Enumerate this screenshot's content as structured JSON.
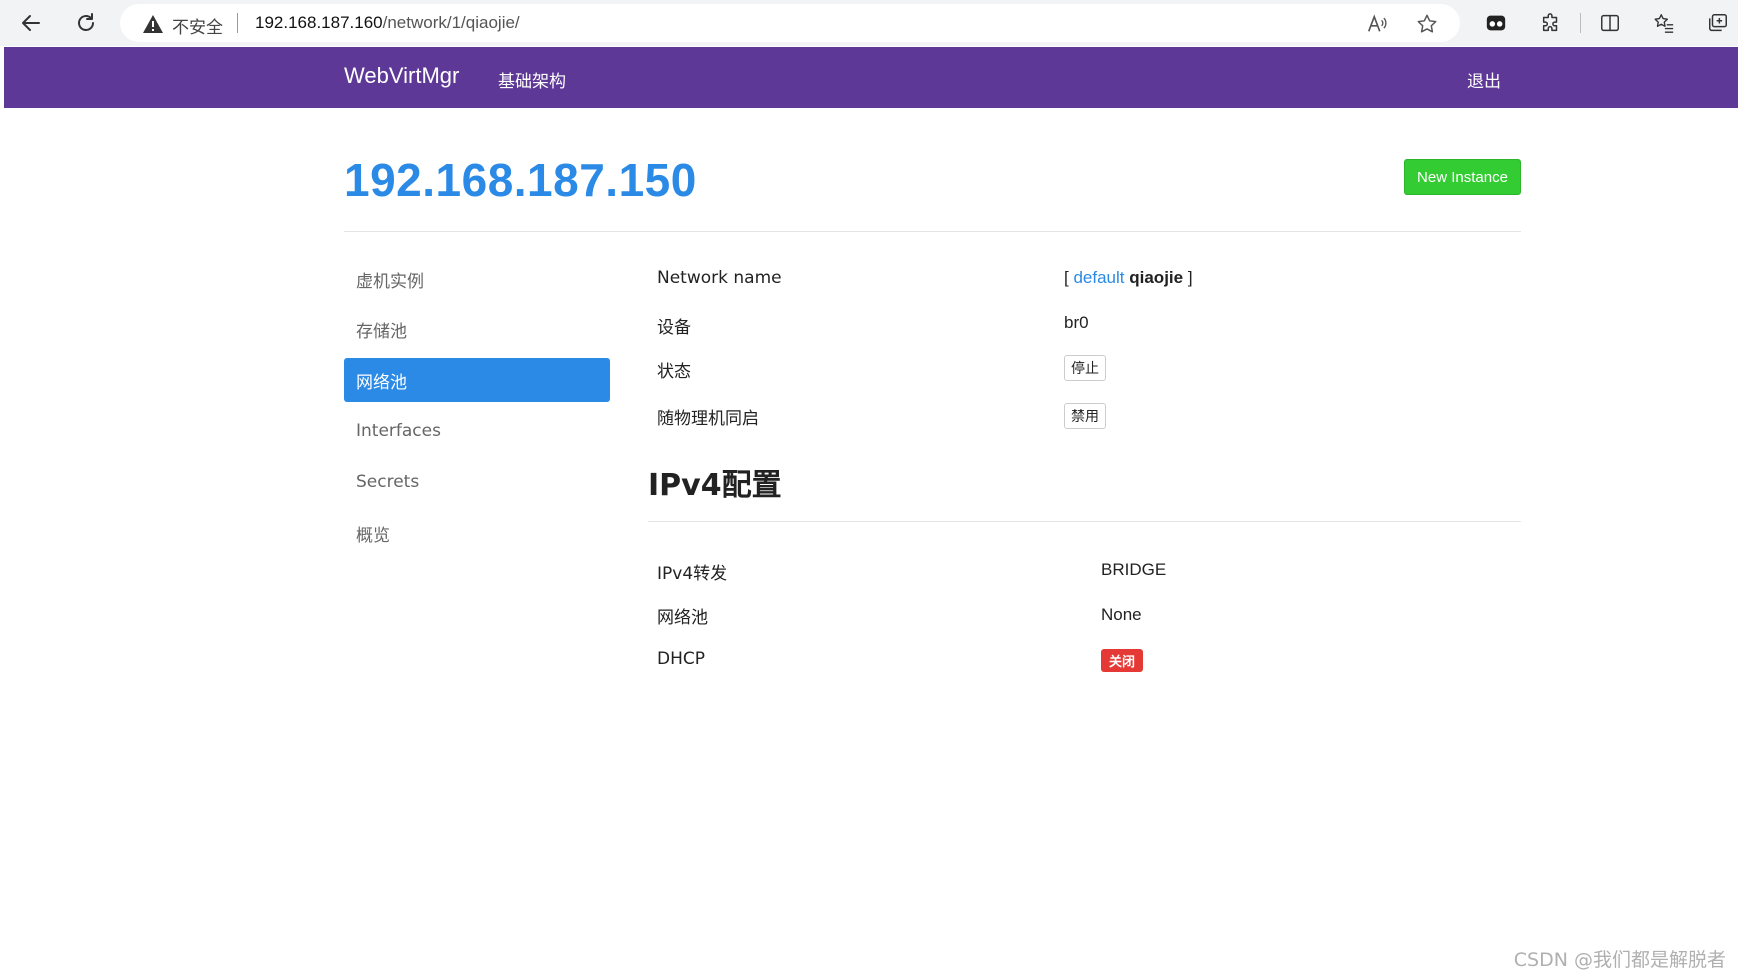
{
  "browser": {
    "security_label": "不安全",
    "url_host": "192.168.187.160",
    "url_path": "/network/1/qiaojie/",
    "icons": [
      "back-arrow-icon",
      "reload-icon",
      "warning-icon",
      "read-aloud-icon",
      "favorite-star-icon",
      "extension-face-icon",
      "extensions-puzzle-icon",
      "split-screen-icon",
      "favorites-list-icon",
      "collections-icon"
    ]
  },
  "navbar": {
    "brand": "WebVirtMgr",
    "infrastructure_label": "基础架构",
    "logout_label": "退出",
    "bg_color": "#5e3896"
  },
  "header": {
    "title": "192.168.187.150",
    "new_instance_label": "New Instance",
    "title_color": "#2a8ae6",
    "button_color": "#33cc33"
  },
  "sidebar": {
    "items": [
      {
        "label": "虚机实例",
        "active": false
      },
      {
        "label": "存储池",
        "active": false
      },
      {
        "label": "网络池",
        "active": true
      },
      {
        "label": "Interfaces",
        "active": false
      },
      {
        "label": "Secrets",
        "active": false
      },
      {
        "label": "概览",
        "active": false
      }
    ]
  },
  "network": {
    "name_label": "Network name",
    "name_bracket_open": "[",
    "name_link": "default",
    "name_current": "qiaojie",
    "name_bracket_close": "]",
    "device_label": "设备",
    "device_value": "br0",
    "state_label": "状态",
    "state_button": "停止",
    "autostart_label": "随物理机同启",
    "autostart_button": "禁用"
  },
  "ipv4": {
    "section_title": "IPv4配置",
    "forward_label": "IPv4转发",
    "forward_value": "BRIDGE",
    "pool_label": "网络池",
    "pool_value": "None",
    "dhcp_label": "DHCP",
    "dhcp_badge": "关闭",
    "badge_color": "#e53935"
  },
  "watermark": "CSDN @我们都是解脱者"
}
